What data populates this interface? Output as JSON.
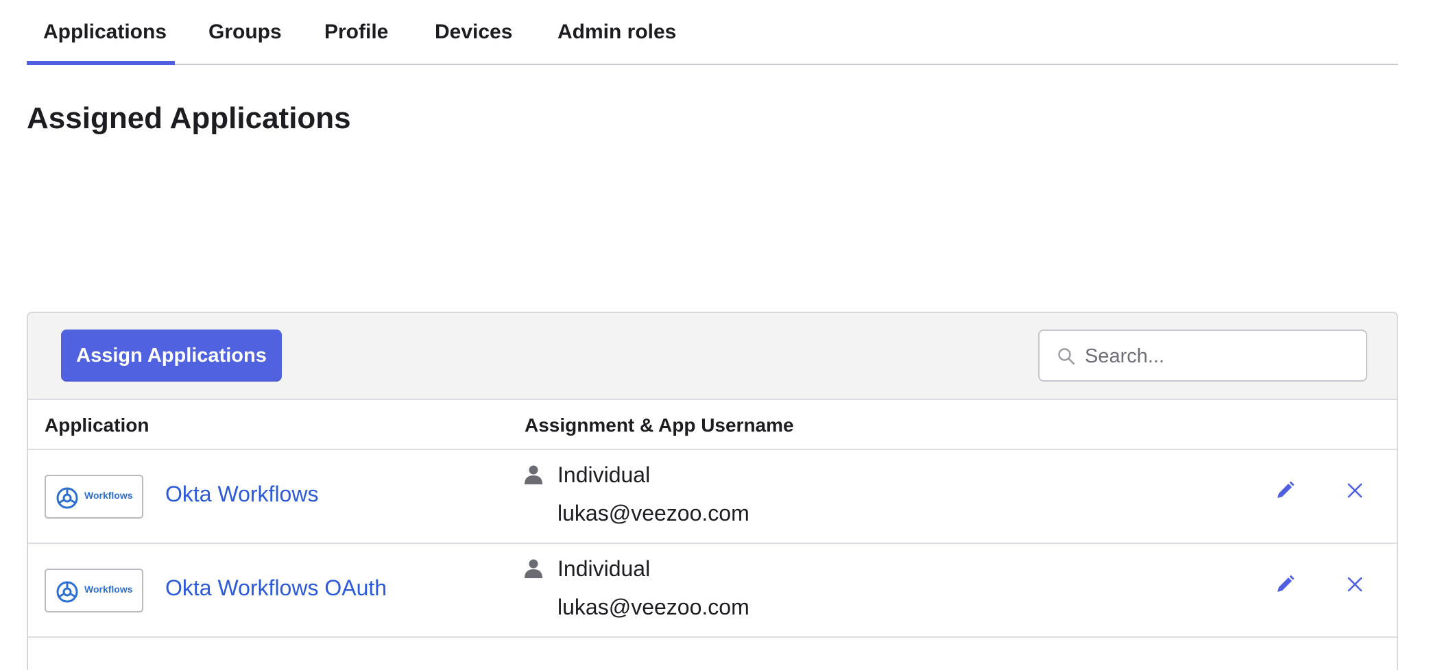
{
  "tabs": [
    {
      "label": "Applications",
      "active": true
    },
    {
      "label": "Groups"
    },
    {
      "label": "Profile"
    },
    {
      "label": "Devices"
    },
    {
      "label": "Admin roles"
    }
  ],
  "page_title": "Assigned Applications",
  "toolbar": {
    "assign_label": "Assign Applications",
    "search_placeholder": "Search..."
  },
  "table": {
    "columns": [
      "Application",
      "Assignment & App Username"
    ],
    "rows": [
      {
        "logo_text": "Workflows",
        "app_name": "Okta Workflows",
        "assignment_type": "Individual",
        "username": "lukas@veezoo.com"
      },
      {
        "logo_text": "Workflows",
        "app_name": "Okta Workflows OAuth",
        "assignment_type": "Individual",
        "username": "lukas@veezoo.com"
      }
    ]
  },
  "colors": {
    "accent": "#5062e0",
    "link": "#2c5ad8",
    "toolbar_bg": "#f3f3f3"
  },
  "icons": [
    "search-icon",
    "person-icon",
    "pencil-icon",
    "close-icon",
    "workflows-logo-icon"
  ]
}
